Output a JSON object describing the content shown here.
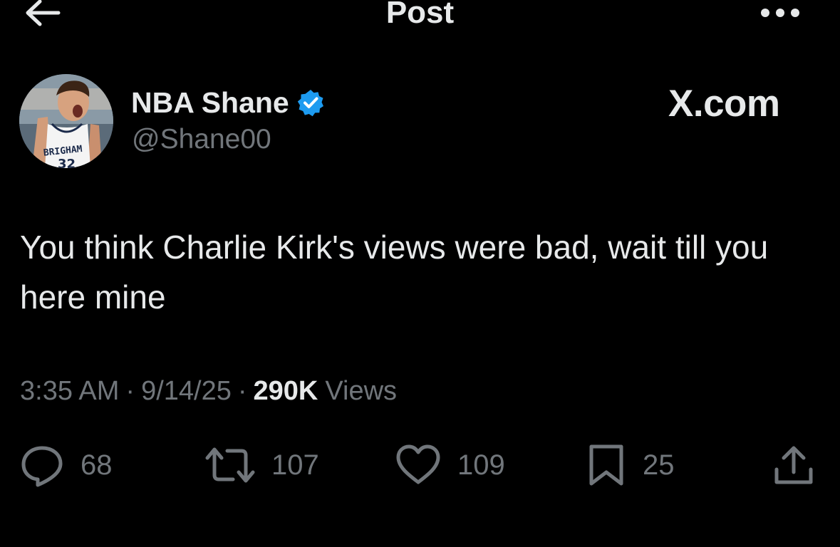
{
  "header": {
    "title": "Post",
    "back_icon": "arrow-left-icon",
    "more_icon": "more-horizontal-icon"
  },
  "author": {
    "display_name": "NBA Shane",
    "handle": "@Shane00",
    "verified_color": "#1d9bf0",
    "avatar_jersey_text": "BRIGHAM",
    "avatar_jersey_number": "32"
  },
  "watermark": "X.com",
  "tweet": {
    "text": "You think Charlie Kirk's views were bad, wait till you here mine"
  },
  "meta": {
    "time": "3:35 AM",
    "date": "9/14/25",
    "views_count": "290K",
    "views_label": "Views"
  },
  "actions": {
    "replies": "68",
    "reposts": "107",
    "likes": "109",
    "bookmarks": "25"
  },
  "colors": {
    "background": "#000000",
    "text": "#e7e9ea",
    "muted": "#71767b",
    "accent": "#1d9bf0"
  }
}
